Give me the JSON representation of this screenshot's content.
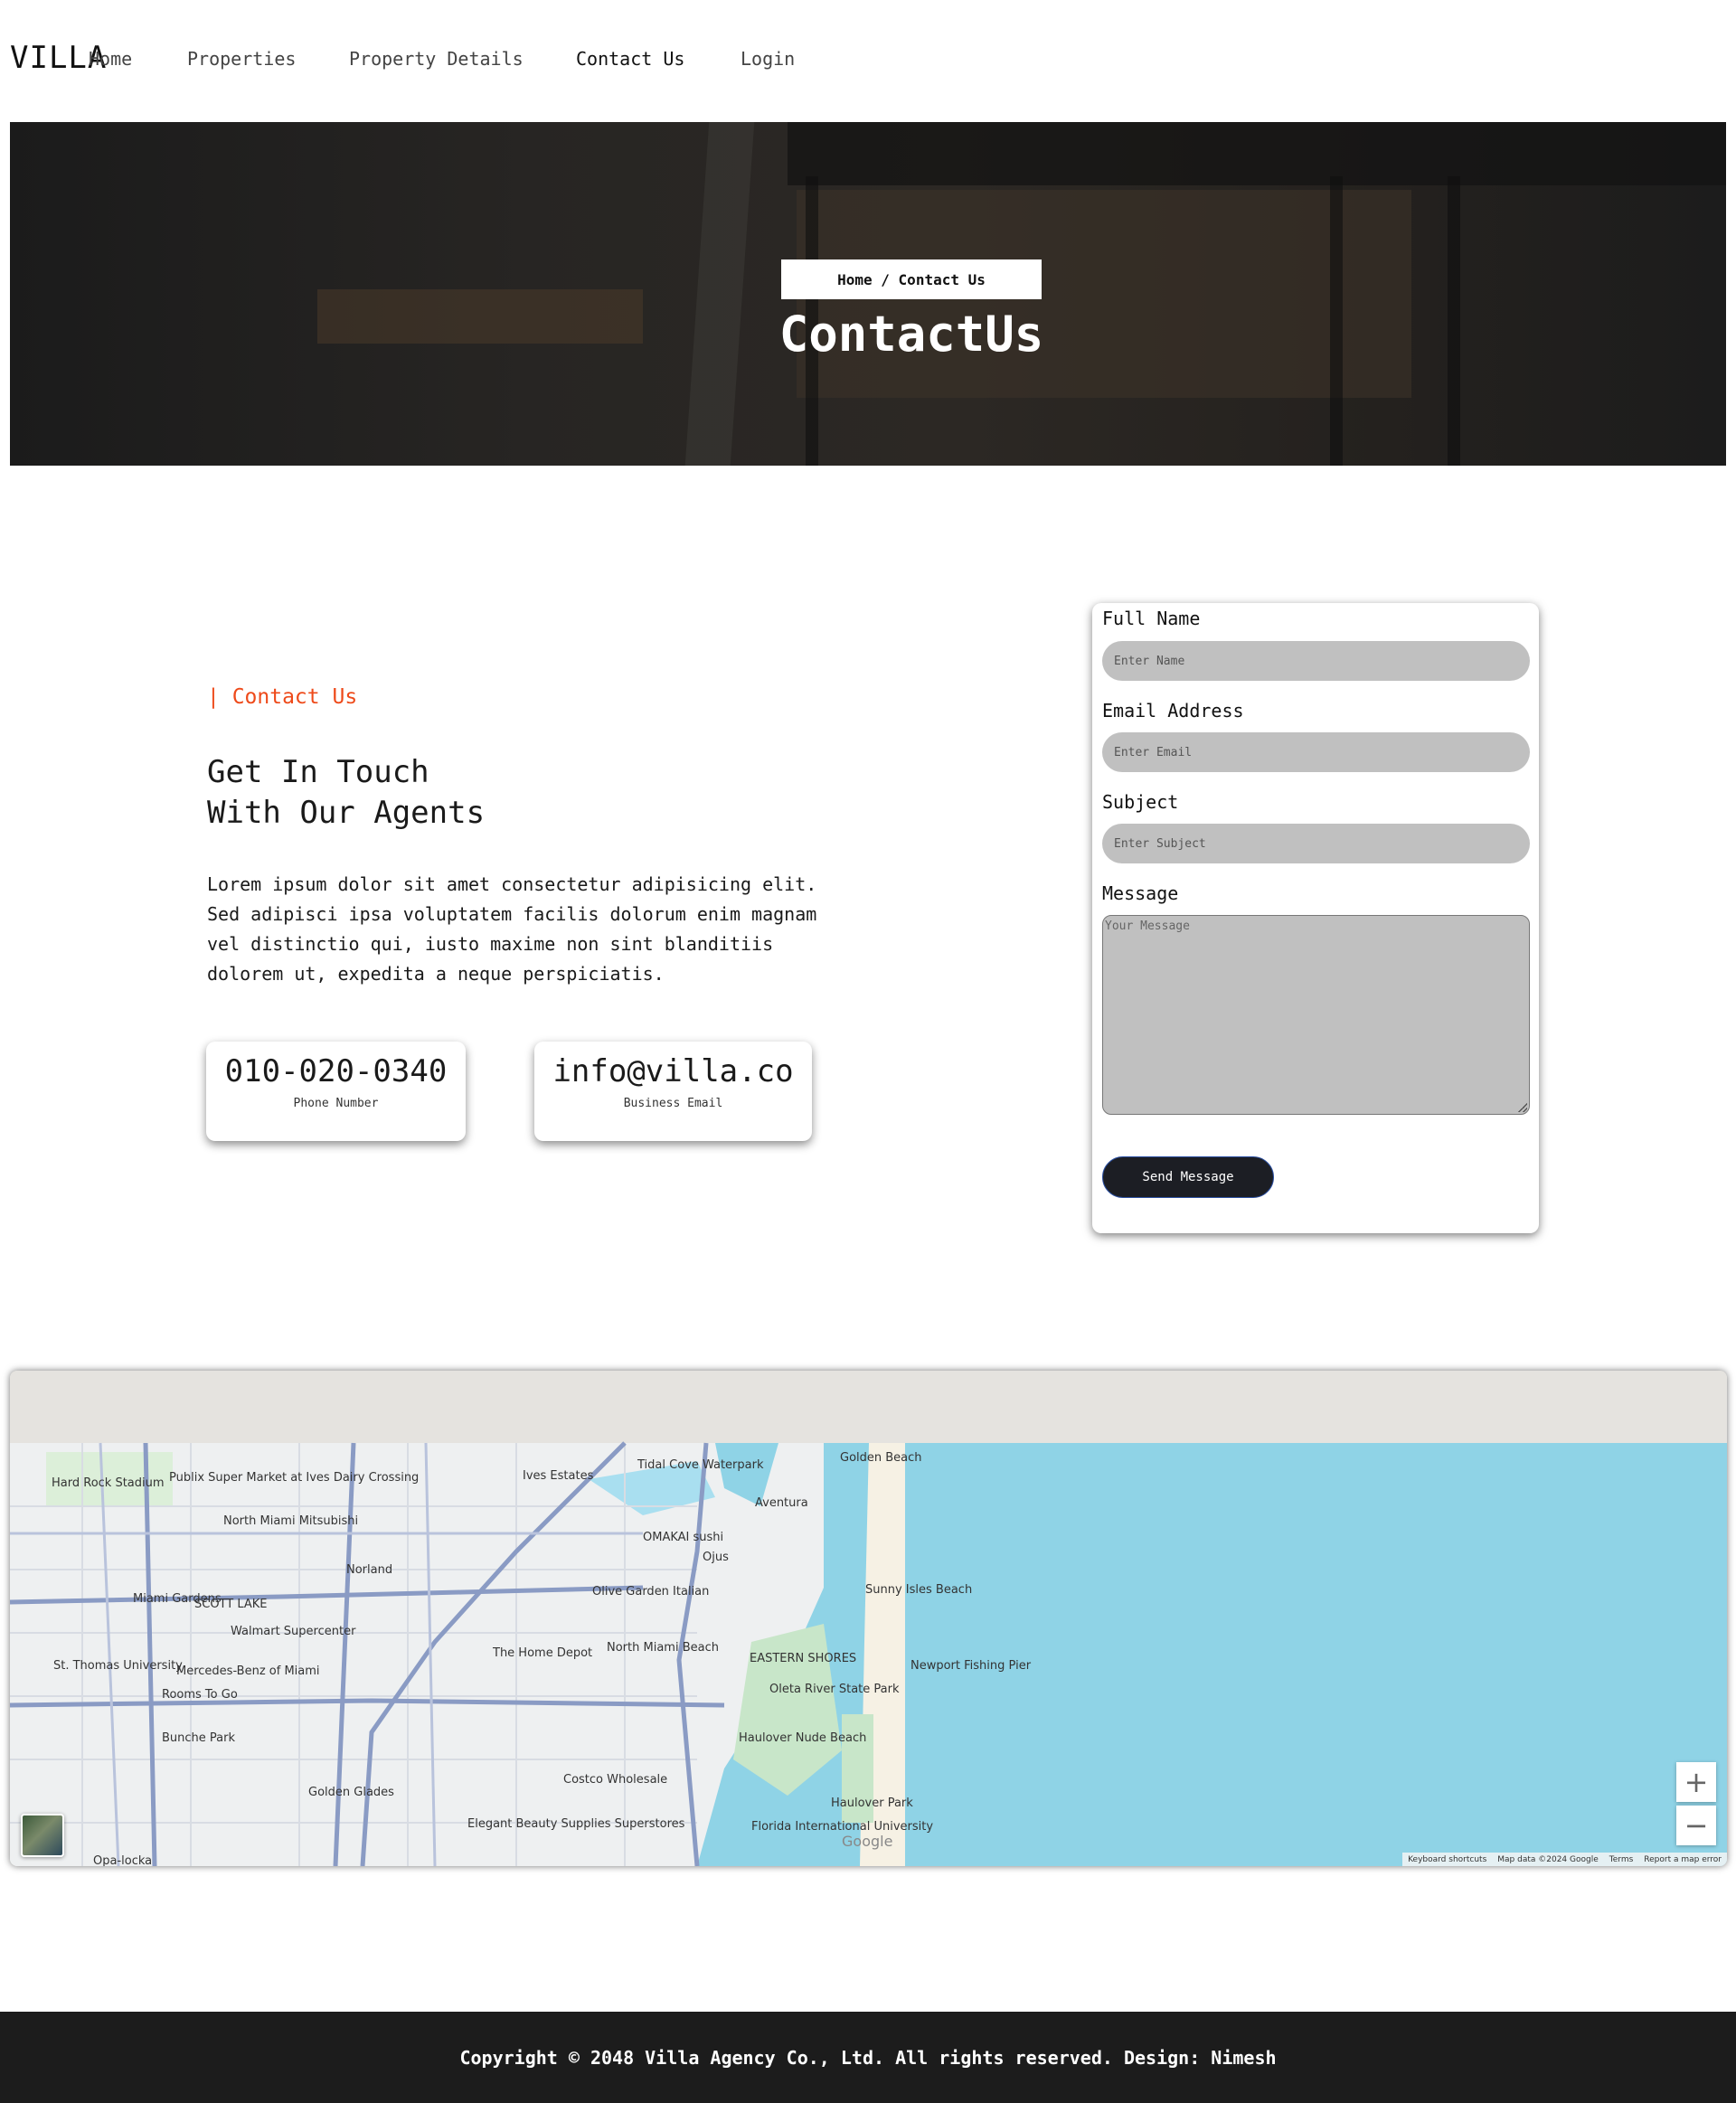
{
  "header": {
    "logo": "VILLA",
    "nav": [
      {
        "label": "Home",
        "active": false
      },
      {
        "label": "Properties",
        "active": false
      },
      {
        "label": "Property Details",
        "active": false
      },
      {
        "label": "Contact Us",
        "active": true
      },
      {
        "label": "Login",
        "active": false
      }
    ]
  },
  "hero": {
    "breadcrumb": {
      "home": "Home",
      "separator": " / ",
      "current": "Contact Us"
    },
    "title": "ContactUs"
  },
  "contact": {
    "tag": "| Contact Us",
    "heading_line1": "Get In Touch",
    "heading_line2": "With Our Agents",
    "description": "Lorem ipsum dolor sit amet consectetur adipisicing elit. Sed adipisci ipsa voluptatem facilis dolorum enim magnam vel distinctio qui, iusto maxime non sint blanditiis dolorem ut, expedita a neque perspiciatis.",
    "phone": {
      "value": "010-020-0340",
      "label": "Phone Number"
    },
    "email": {
      "value": "info@villa.co",
      "label": "Business Email"
    }
  },
  "form": {
    "name_label": "Full Name",
    "name_placeholder": "Enter Name",
    "email_label": "Email Address",
    "email_placeholder": "Enter Email",
    "subject_label": "Subject",
    "subject_placeholder": "Enter Subject",
    "message_label": "Message",
    "message_placeholder": "Your Message",
    "submit_label": "Send Message"
  },
  "map": {
    "places": [
      "Golden Beach",
      "Tidal Cove Waterpark",
      "Ives Estates",
      "Hard Rock Stadium",
      "Publix Super Market at Ives Dairy Crossing",
      "Aventura",
      "North Miami Mitsubishi",
      "OMAKAI sushi",
      "Norland",
      "Ojus",
      "Olive Garden Italian",
      "Sunny Isles Beach",
      "Miami Gardens",
      "SCOTT LAKE",
      "Walmart Supercenter",
      "The Home Depot",
      "North Miami Beach",
      "EASTERN SHORES",
      "Newport Fishing Pier",
      "Mercedes-Benz of Miami",
      "St. Thomas University",
      "Rooms To Go",
      "Oleta River State Park",
      "Haulover Nude Beach",
      "Bunche Park",
      "Costco Wholesale",
      "Haulover Park",
      "Golden Glades",
      "Elegant Beauty Supplies Superstores",
      "Florida International University",
      "Opa-locka"
    ],
    "zoom_in": "+",
    "zoom_out": "−",
    "attribution": [
      "Keyboard shortcuts",
      "Map data ©2024 Google",
      "Terms",
      "Report a map error"
    ],
    "google_logo": "Google",
    "colors": {
      "water": "#8fd3e6",
      "land": "#eef0f1",
      "park": "#c8e6c9",
      "road": "#8a9bc4"
    }
  },
  "footer": {
    "text": "Copyright © 2048 Villa Agency Co., Ltd. All rights reserved. Design: Nimesh"
  },
  "theme": {
    "accent": "#ee4a1a",
    "dark": "#1c1c1c",
    "input_bg": "#c0c0c0"
  }
}
